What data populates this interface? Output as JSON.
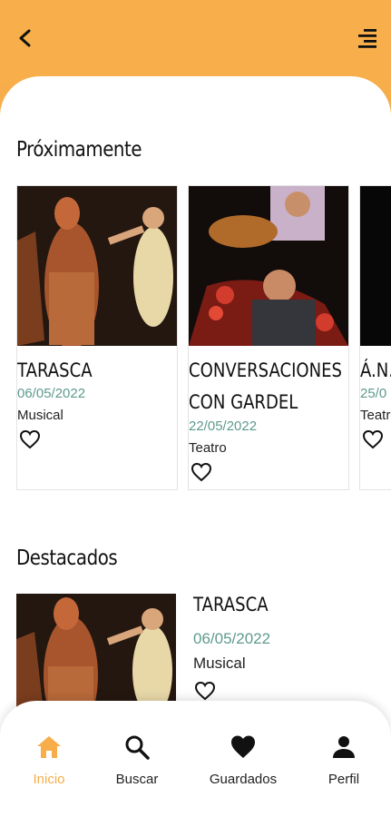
{
  "header": {
    "back_icon": "arrow-back-icon",
    "menu_icon": "menu-icon"
  },
  "sections": {
    "upcoming_title": "Próximamente",
    "featured_title": "Destacados"
  },
  "upcoming": [
    {
      "title": "TARASCA",
      "date": "06/05/2022",
      "category": "Musical"
    },
    {
      "title": "CONVERSACIONES\nCON GARDEL",
      "date": "22/05/2022",
      "category": "Teatro"
    },
    {
      "title": "Á.N.",
      "date": "25/0",
      "category": "Teatr"
    }
  ],
  "featured": [
    {
      "title": "TARASCA",
      "date": "06/05/2022",
      "category": "Musical"
    }
  ],
  "nav": {
    "items": [
      {
        "label": "Inicio",
        "icon": "home-icon",
        "active": true
      },
      {
        "label": "Buscar",
        "icon": "search-icon",
        "active": false
      },
      {
        "label": "Guardados",
        "icon": "heart-icon",
        "active": false
      },
      {
        "label": "Perfil",
        "icon": "person-icon",
        "active": false
      }
    ]
  },
  "colors": {
    "accent": "#f6ad4a",
    "date": "#5e9a8c",
    "text": "#111111"
  }
}
